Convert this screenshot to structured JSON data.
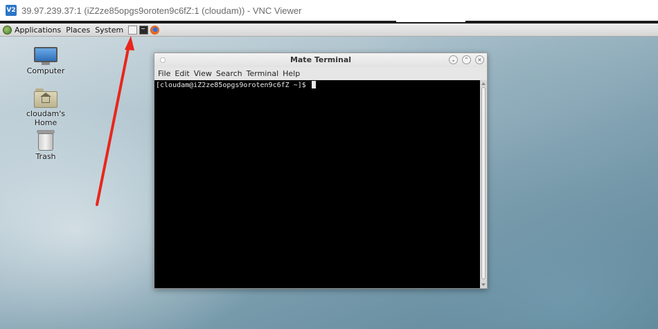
{
  "window": {
    "logo_text": "V2",
    "title": "39.97.239.37:1 (iZ2ze85opgs9oroten9c6fZ:1 (cloudam)) - VNC Viewer"
  },
  "panel": {
    "menus": [
      "Applications",
      "Places",
      "System"
    ],
    "launchers": [
      "text-editor-icon",
      "terminal-icon",
      "firefox-icon"
    ]
  },
  "desktop_icons": [
    {
      "label": "Computer",
      "icon": "computer-icon"
    },
    {
      "label": "cloudam's Home",
      "icon": "home-folder-icon"
    },
    {
      "label": "Trash",
      "icon": "trash-icon"
    }
  ],
  "terminal": {
    "title": "Mate Terminal",
    "menu": [
      "File",
      "Edit",
      "View",
      "Search",
      "Terminal",
      "Help"
    ],
    "prompt": "[cloudam@iZ2ze85opgs9oroten9c6fZ ~]$ ",
    "buttons": {
      "minimize": "⌄",
      "maximize": "⌃",
      "close": "×"
    }
  },
  "colors": {
    "annotation_arrow": "#e8261c",
    "terminal_background": "#000000",
    "terminal_text": "#e8e8e8"
  }
}
